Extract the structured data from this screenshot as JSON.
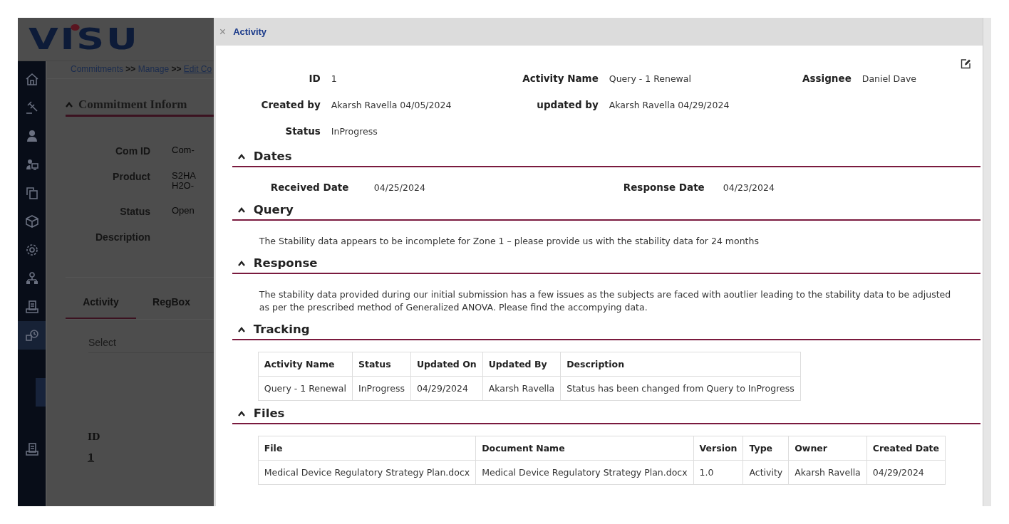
{
  "app": {
    "logo": "VISU",
    "sidebar": [
      {
        "kind": "home",
        "selected": false
      },
      {
        "kind": "gavel",
        "selected": false
      },
      {
        "kind": "user",
        "selected": false
      },
      {
        "kind": "usermonitor",
        "selected": false
      },
      {
        "kind": "copy",
        "selected": false
      },
      {
        "kind": "cube",
        "selected": false
      },
      {
        "kind": "gear",
        "selected": false
      },
      {
        "kind": "network",
        "selected": false
      },
      {
        "kind": "document",
        "selected": false
      },
      {
        "kind": "clock",
        "selected": true
      }
    ],
    "sidebar_bottom": [
      {
        "kind": "document",
        "selected": false
      }
    ],
    "breadcrumb": [
      {
        "kind": "link",
        "text": "Commitments"
      },
      {
        "kind": "sep",
        "text": ">>"
      },
      {
        "kind": "link",
        "text": "Manage"
      },
      {
        "kind": "sep",
        "text": ">>"
      },
      {
        "kind": "current",
        "text": "Edit Co"
      }
    ],
    "section_title": "Commitment Inform",
    "fields": [
      {
        "label": "Com ID",
        "value": "Com-"
      },
      {
        "label": "Product",
        "value": "S2HA\nH2O-"
      },
      {
        "label": "Status",
        "value": "Open"
      },
      {
        "label": "Description"
      }
    ],
    "tabs": [
      {
        "label": "Activity",
        "selected": true
      },
      {
        "label": "RegBox",
        "selected": false
      }
    ],
    "select": {
      "placeholder": "Select"
    },
    "table": {
      "columns": [
        "ID"
      ],
      "rows": [
        [
          "1"
        ]
      ]
    }
  },
  "modal": {
    "close": "×",
    "title": "Activity",
    "info": [
      [
        {
          "label": "ID",
          "value": "1"
        },
        {
          "label": "Activity Name",
          "value": "Query - 1 Renewal"
        },
        {
          "label": "Assignee",
          "value": "Daniel Dave"
        }
      ],
      [
        {
          "label": "Created by",
          "value": "Akarsh Ravella 04/05/2024"
        },
        {
          "label": "updated by",
          "value": "Akarsh Ravella 04/29/2024"
        }
      ],
      [
        {
          "label": "Status",
          "value": "InProgress"
        }
      ]
    ],
    "sections": [
      {
        "kind": "fields",
        "title": "Dates",
        "fields": [
          {
            "label": "Received Date",
            "value": "04/25/2024"
          },
          {
            "label": "Response Date",
            "value": "04/23/2024"
          }
        ]
      },
      {
        "kind": "text",
        "title": "Query",
        "text": "The Stability data appears to be incomplete for Zone 1 – please provide us with the stability data for 24 months"
      },
      {
        "kind": "text",
        "title": "Response",
        "text": "The stability data provided during our initial submission has a few issues as the subjects are faced with aoutlier leading to the stability data to be adjusted as per the prescribed method of Generalized ANOVA. Please find the accompying data."
      },
      {
        "kind": "table",
        "title": "Tracking",
        "columns": [
          "Activity Name",
          "Status",
          "Updated On",
          "Updated By",
          "Description"
        ],
        "rows": [
          [
            "Query - 1 Renewal",
            "InProgress",
            "04/29/2024",
            "Akarsh Ravella",
            "Status has been changed from Query to InProgress"
          ]
        ]
      },
      {
        "kind": "table",
        "title": "Files",
        "columns": [
          "File",
          "Document Name",
          "Version",
          "Type",
          "Owner",
          "Created Date"
        ],
        "rows": [
          [
            "Medical Device Regulatory Strategy Plan.docx",
            "Medical Device Regulatory Strategy Plan.docx",
            "1.0",
            "Activity",
            "Akarsh Ravella",
            "04/29/2024"
          ]
        ]
      }
    ]
  }
}
